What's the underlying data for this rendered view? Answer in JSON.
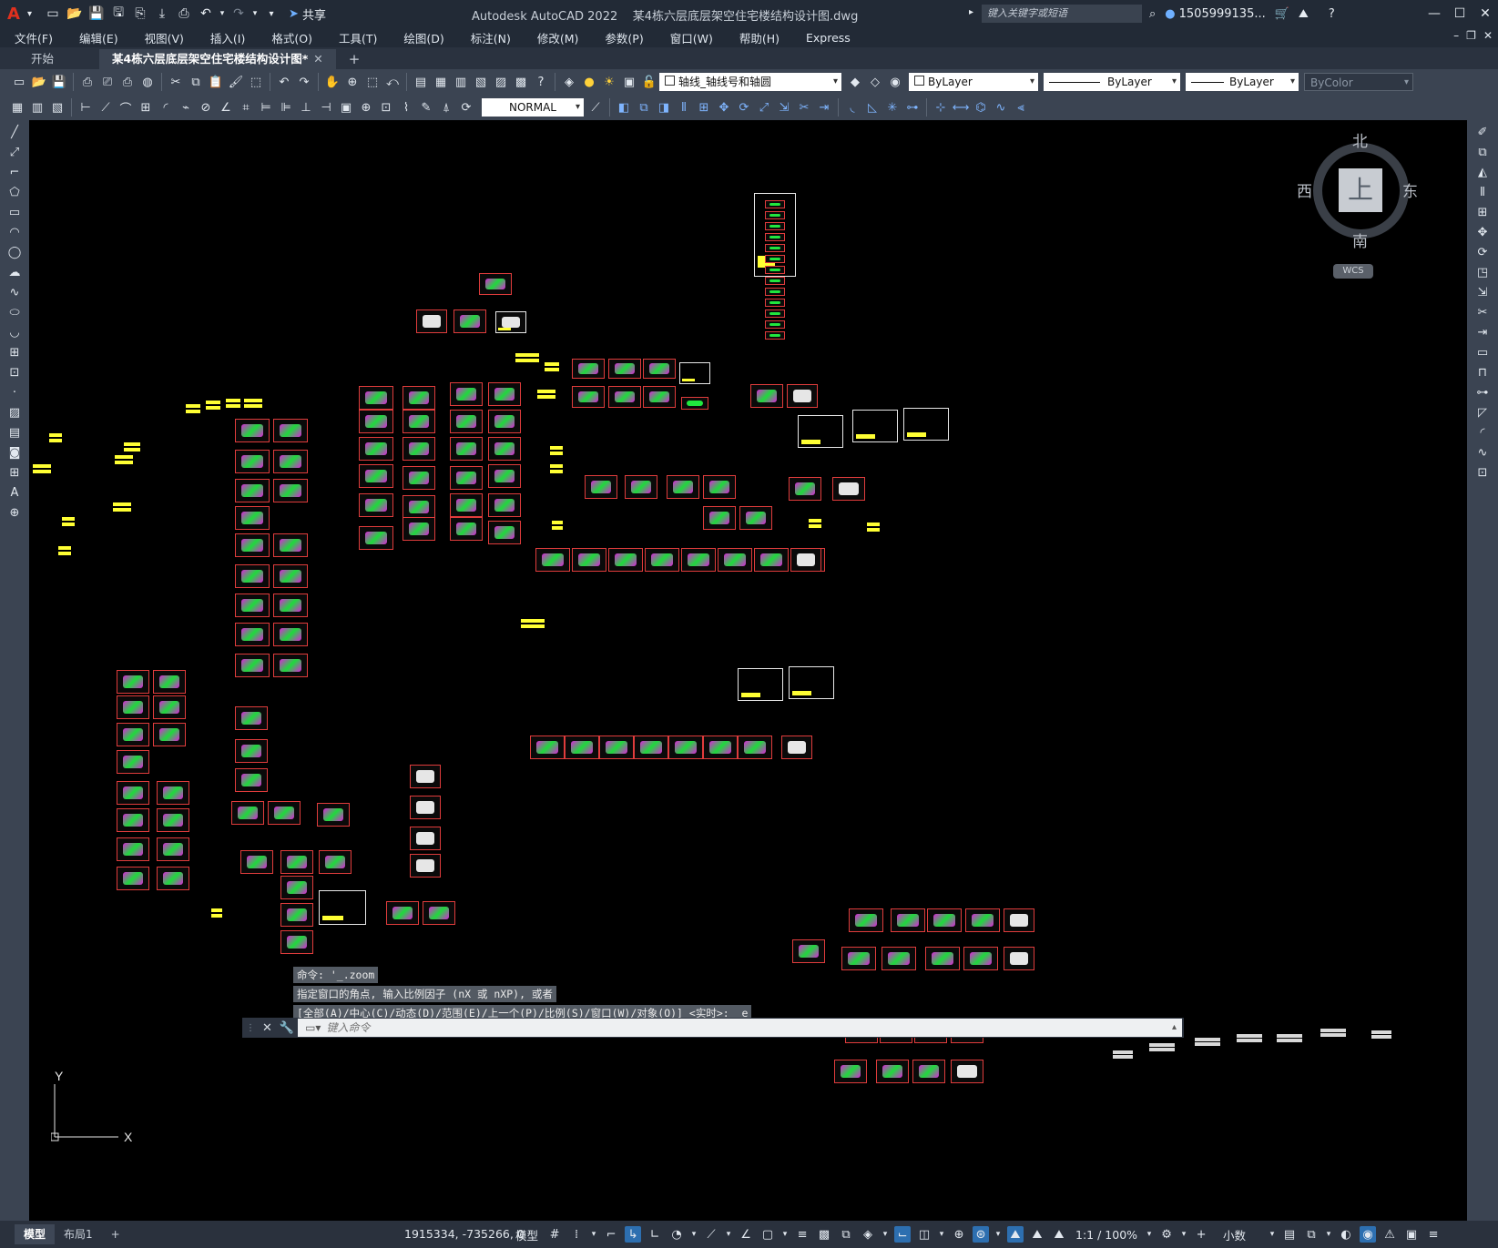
{
  "title_bar": {
    "app_name": "Autodesk AutoCAD 2022",
    "file_name": "某4栋六层底层架空住宅楼结构设计图.dwg",
    "share_label": "共享",
    "search_placeholder": "键入关键字或短语",
    "user_name": "1505999135...",
    "icons": [
      "app-menu-icon",
      "new-icon",
      "open-icon",
      "save-icon",
      "saveas-icon",
      "publish-icon",
      "plot-icon",
      "undo-icon",
      "redo-icon",
      "share-icon",
      "search-icon",
      "user-icon",
      "cart-icon",
      "help-icon"
    ]
  },
  "menu": {
    "items": [
      "文件(F)",
      "编辑(E)",
      "视图(V)",
      "插入(I)",
      "格式(O)",
      "工具(T)",
      "绘图(D)",
      "标注(N)",
      "修改(M)",
      "参数(P)",
      "窗口(W)",
      "帮助(H)",
      "Express"
    ]
  },
  "tabs": {
    "start": "开始",
    "active": "某4栋六层底层架空住宅楼结构设计图*"
  },
  "toolbar": {
    "layer_name": "轴线_轴线号和轴圆",
    "color": "ByLayer",
    "linetype": "ByLayer",
    "lineweight": "ByLayer",
    "plotstyle": "ByColor",
    "dimstyle": "NORMAL"
  },
  "viewcube": {
    "north": "北",
    "south": "南",
    "east": "东",
    "west": "西",
    "face": "上",
    "wcs": "WCS"
  },
  "ucs": {
    "x_label": "X",
    "y_label": "Y"
  },
  "command": {
    "history": [
      "命令: '_.zoom",
      "指定窗口的角点, 输入比例因子 (nX 或 nXP), 或者",
      "[全部(A)/中心(C)/动态(D)/范围(E)/上一个(P)/比例(S)/窗口(W)/对象(O)] <实时>: _e"
    ],
    "placeholder": "键入命令"
  },
  "status": {
    "tabs": [
      "模型",
      "布局1"
    ],
    "coordinates": "1915334, -735266, 0",
    "model_label": "模型",
    "scale": "1:1 / 100%",
    "units": "小数"
  },
  "colors": {
    "canvas": "#000000",
    "drawing_border": "#e03c3c",
    "magenta": "#ff28ff",
    "green": "#22ff44",
    "yellow": "#ffff33"
  }
}
